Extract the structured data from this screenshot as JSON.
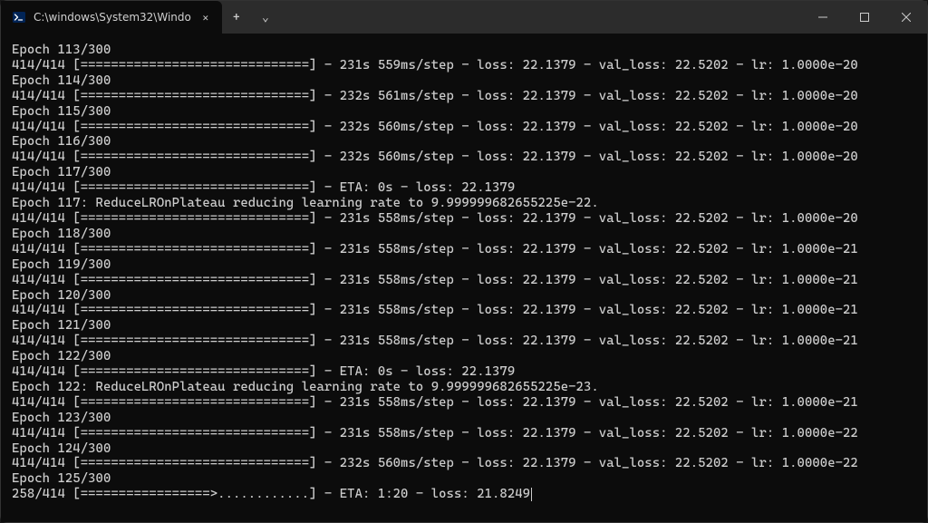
{
  "titlebar": {
    "tab_title": "C:\\windows\\System32\\Windo"
  },
  "icons": {
    "ps": "PS",
    "close": "✕",
    "plus": "+",
    "chevron": "⌄",
    "min": "─",
    "max": "□",
    "winclose": "✕"
  },
  "lines": [
    "Epoch 113/300",
    "414/414 [==============================] - 231s 559ms/step - loss: 22.1379 - val_loss: 22.5202 - lr: 1.0000e-20",
    "Epoch 114/300",
    "414/414 [==============================] - 232s 561ms/step - loss: 22.1379 - val_loss: 22.5202 - lr: 1.0000e-20",
    "Epoch 115/300",
    "414/414 [==============================] - 232s 560ms/step - loss: 22.1379 - val_loss: 22.5202 - lr: 1.0000e-20",
    "Epoch 116/300",
    "414/414 [==============================] - 232s 560ms/step - loss: 22.1379 - val_loss: 22.5202 - lr: 1.0000e-20",
    "Epoch 117/300",
    "414/414 [==============================] - ETA: 0s - loss: 22.1379",
    "Epoch 117: ReduceLROnPlateau reducing learning rate to 9.999999682655225e-22.",
    "414/414 [==============================] - 231s 558ms/step - loss: 22.1379 - val_loss: 22.5202 - lr: 1.0000e-20",
    "Epoch 118/300",
    "414/414 [==============================] - 231s 558ms/step - loss: 22.1379 - val_loss: 22.5202 - lr: 1.0000e-21",
    "Epoch 119/300",
    "414/414 [==============================] - 231s 558ms/step - loss: 22.1379 - val_loss: 22.5202 - lr: 1.0000e-21",
    "Epoch 120/300",
    "414/414 [==============================] - 231s 558ms/step - loss: 22.1379 - val_loss: 22.5202 - lr: 1.0000e-21",
    "Epoch 121/300",
    "414/414 [==============================] - 231s 558ms/step - loss: 22.1379 - val_loss: 22.5202 - lr: 1.0000e-21",
    "Epoch 122/300",
    "414/414 [==============================] - ETA: 0s - loss: 22.1379",
    "Epoch 122: ReduceLROnPlateau reducing learning rate to 9.999999682655225e-23.",
    "414/414 [==============================] - 231s 558ms/step - loss: 22.1379 - val_loss: 22.5202 - lr: 1.0000e-21",
    "Epoch 123/300",
    "414/414 [==============================] - 231s 558ms/step - loss: 22.1379 - val_loss: 22.5202 - lr: 1.0000e-22",
    "Epoch 124/300",
    "414/414 [==============================] - 232s 560ms/step - loss: 22.1379 - val_loss: 22.5202 - lr: 1.0000e-22",
    "Epoch 125/300",
    "258/414 [=================>............] - ETA: 1:20 - loss: 21.8249"
  ]
}
